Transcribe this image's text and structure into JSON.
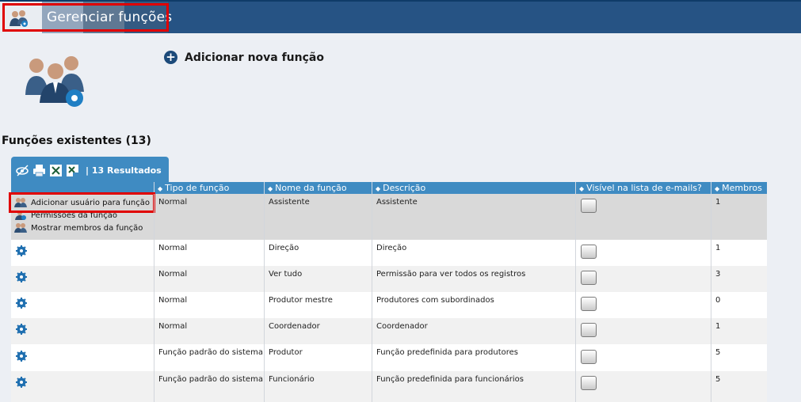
{
  "header": {
    "title": "Gerenciar funções",
    "icon": "group-settings-icon",
    "colors": {
      "bar": "#265384",
      "highlight": "#e00000"
    }
  },
  "actions": {
    "add_new_label": "Adicionar nova função"
  },
  "section": {
    "title": "Funções existentes (13)"
  },
  "toolbar": {
    "tools": [
      "column-visibility-icon",
      "print-icon",
      "excel-export-icon",
      "excel-export-all-icon"
    ],
    "result_count": "| 13 Resultados"
  },
  "table": {
    "columns": [
      "Tipo de função",
      "Nome da função",
      "Descrição",
      "Visível na lista de e-mails?",
      "Membros"
    ],
    "row_menu": [
      "Adicionar usuário para função",
      "Permissões da função",
      "Mostrar membros da função"
    ],
    "rows": [
      {
        "type": "Normal",
        "name": "Assistente",
        "description": "Assistente",
        "members": "1"
      },
      {
        "type": "Normal",
        "name": "Direção",
        "description": "Direção",
        "members": "1"
      },
      {
        "type": "Normal",
        "name": "Ver tudo",
        "description": "Permissão para ver todos os registros",
        "members": "3"
      },
      {
        "type": "Normal",
        "name": "Produtor mestre",
        "description": "Produtores com subordinados",
        "members": "0"
      },
      {
        "type": "Normal",
        "name": "Coordenador",
        "description": "Coordenador",
        "members": "1"
      },
      {
        "type": "Função padrão do sistema",
        "name": "Produtor",
        "description": "Função predefinida para produtores",
        "members": "5"
      },
      {
        "type": "Função padrão do sistema",
        "name": "Funcionário",
        "description": "Função predefinida para funcionários",
        "members": "5"
      }
    ]
  }
}
